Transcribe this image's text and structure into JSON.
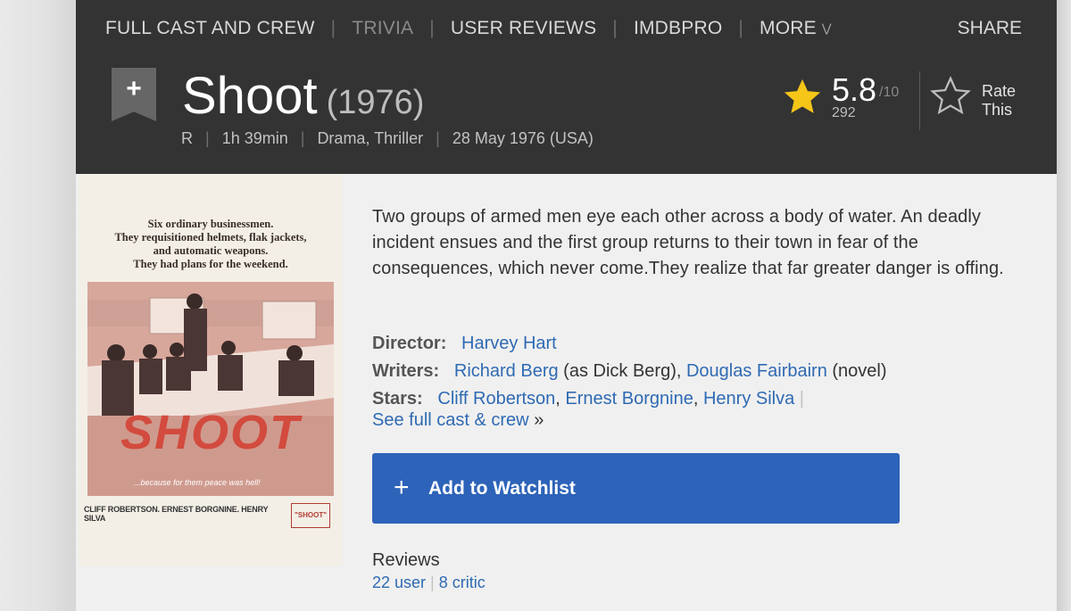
{
  "subnav": {
    "items": [
      {
        "label": "FULL CAST AND CREW",
        "active": true
      },
      {
        "label": "TRIVIA",
        "active": false
      },
      {
        "label": "USER REVIEWS",
        "active": true
      },
      {
        "label": "IMDbPro",
        "active": true
      },
      {
        "label": "MORE",
        "active": true
      }
    ],
    "share": "SHARE"
  },
  "movie": {
    "title": "Shoot",
    "year": "(1976)",
    "rating": "R",
    "runtime": "1h 39min",
    "genres": "Drama, Thriller",
    "release": "28 May 1976 (USA)"
  },
  "imdb_rating": {
    "score": "5.8",
    "max": "/10",
    "votes": "292",
    "rate_label_1": "Rate",
    "rate_label_2": "This"
  },
  "poster": {
    "tagline_1": "Six ordinary businessmen.",
    "tagline_2": "They requisitioned helmets, flak jackets,",
    "tagline_3": "and automatic weapons.",
    "tagline_4": "They had plans for the weekend.",
    "title": "SHOOT",
    "subtitle": "...because for them peace was hell!",
    "credits": "CLIFF ROBERTSON. ERNEST BORGNINE. HENRY SILVA",
    "credit_logo": "\"SHOOT\""
  },
  "plot": "Two groups of armed men eye each other across a body of water. An deadly incident ensues and the first group returns to their town in fear of the consequences, which never come.They realize that far greater danger is offing.",
  "credits": {
    "director_label": "Director:",
    "director": "Harvey Hart",
    "writers_label": "Writers:",
    "writer_1": "Richard Berg",
    "writer_1_note": " (as Dick Berg), ",
    "writer_2": "Douglas Fairbairn",
    "writer_2_note": " (novel)",
    "stars_label": "Stars:",
    "star_1": "Cliff Robertson",
    "star_2": "Ernest Borgnine",
    "star_3": "Henry Silva",
    "full_cast": "See full cast & crew",
    "full_cast_arrow": "»"
  },
  "watchlist": {
    "plus": "+",
    "label": "Add to Watchlist"
  },
  "reviews": {
    "heading": "Reviews",
    "user": "22 user",
    "critic": "8 critic"
  },
  "colors": {
    "header_bg": "#333333",
    "link": "#2f6ab3",
    "button": "#2d63b9",
    "star": "#f5c518"
  }
}
